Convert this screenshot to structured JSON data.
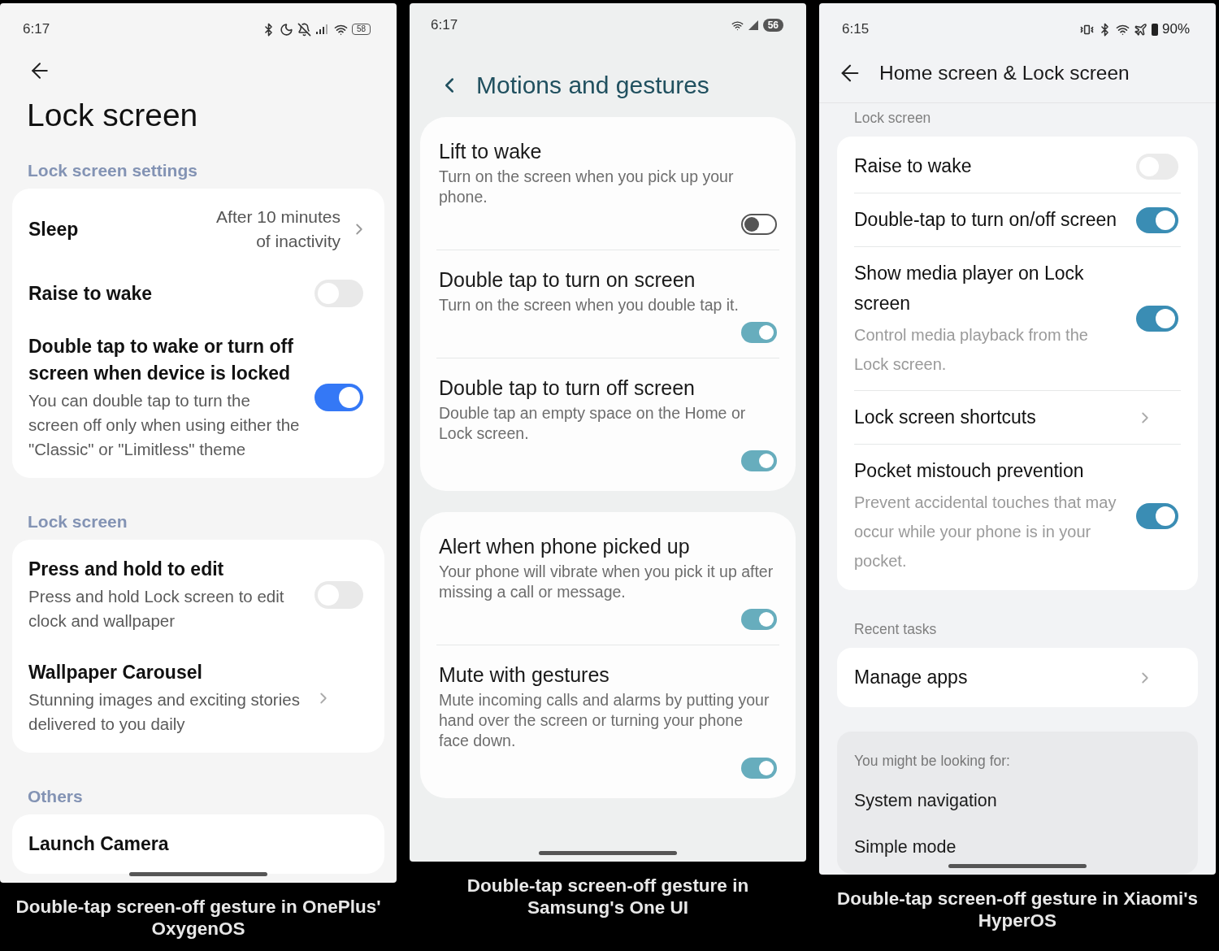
{
  "panels": [
    {
      "kind": "oxygen",
      "status": {
        "time": "6:17",
        "battery": "58"
      },
      "title": "Lock screen",
      "sections": [
        {
          "kind": "list",
          "header": "Lock screen settings",
          "items": [
            {
              "kind": "value",
              "title": "Sleep",
              "value": "After 10 minutes of inactivity"
            },
            {
              "kind": "toggle",
              "title": "Raise to wake",
              "on": false
            },
            {
              "kind": "toggle",
              "title": "Double tap to wake or turn off screen when device is locked",
              "subtitle": "You can double tap to turn the screen off only when using either the \"Classic\" or \"Limitless\" theme",
              "on": true
            }
          ]
        },
        {
          "kind": "list",
          "header": "Lock screen",
          "items": [
            {
              "kind": "toggle",
              "title": "Press and hold to edit",
              "subtitle": "Press and hold Lock screen to edit clock and wallpaper",
              "on": false
            },
            {
              "kind": "link",
              "title": "Wallpaper Carousel",
              "subtitle": "Stunning images and exciting stories delivered to you daily"
            }
          ]
        },
        {
          "kind": "list",
          "header": "Others",
          "items": [
            {
              "kind": "plain",
              "title": "Launch Camera"
            }
          ]
        }
      ],
      "caption": "Double-tap screen-off gesture in OnePlus' OxygenOS"
    },
    {
      "kind": "oneui",
      "status": {
        "time": "6:17",
        "battery": "56"
      },
      "title": "Motions and gestures",
      "sections": [
        {
          "kind": "list",
          "items": [
            {
              "kind": "toggle",
              "title": "Lift to wake",
              "subtitle": "Turn on the screen when you pick up your phone.",
              "on": false
            },
            {
              "kind": "toggle",
              "title": "Double tap to turn on screen",
              "subtitle": "Turn on the screen when you double tap it.",
              "on": true
            },
            {
              "kind": "toggle",
              "title": "Double tap to turn off screen",
              "subtitle": "Double tap an empty space on the Home or Lock screen.",
              "on": true
            }
          ]
        },
        {
          "kind": "list",
          "items": [
            {
              "kind": "toggle",
              "title": "Alert when phone picked up",
              "subtitle": "Your phone will vibrate when you pick it up after missing a call or message.",
              "on": true
            },
            {
              "kind": "toggle",
              "title": "Mute with gestures",
              "subtitle": "Mute incoming calls and alarms by putting your hand over the screen or turning your phone face down.",
              "on": true
            }
          ]
        }
      ],
      "caption": "Double-tap screen-off gesture in Samsung's One UI"
    },
    {
      "kind": "hyperos",
      "status": {
        "time": "6:15",
        "battery": "90%"
      },
      "title": "Home screen & Lock screen",
      "sections": [
        {
          "kind": "list",
          "header": "Lock screen",
          "items": [
            {
              "kind": "toggle",
              "title": "Raise to wake",
              "on": false
            },
            {
              "kind": "toggle",
              "title": "Double-tap to turn on/off screen",
              "on": true
            },
            {
              "kind": "toggle",
              "title": "Show media player on Lock screen",
              "subtitle": "Control media playback from the Lock screen.",
              "on": true
            },
            {
              "kind": "link",
              "title": "Lock screen shortcuts"
            },
            {
              "kind": "toggle",
              "title": "Pocket mistouch prevention",
              "subtitle": "Prevent accidental touches that may occur while your phone is in your pocket.",
              "on": true
            }
          ]
        },
        {
          "kind": "list",
          "header": "Recent tasks",
          "items": [
            {
              "kind": "link",
              "title": "Manage apps"
            }
          ]
        },
        {
          "kind": "suggestions",
          "header": "You might be looking for:",
          "items": [
            {
              "kind": "plain",
              "title": "System navigation"
            },
            {
              "kind": "plain",
              "title": "Simple mode"
            }
          ]
        }
      ],
      "caption": "Double-tap screen-off gesture in Xiaomi's HyperOS"
    }
  ]
}
